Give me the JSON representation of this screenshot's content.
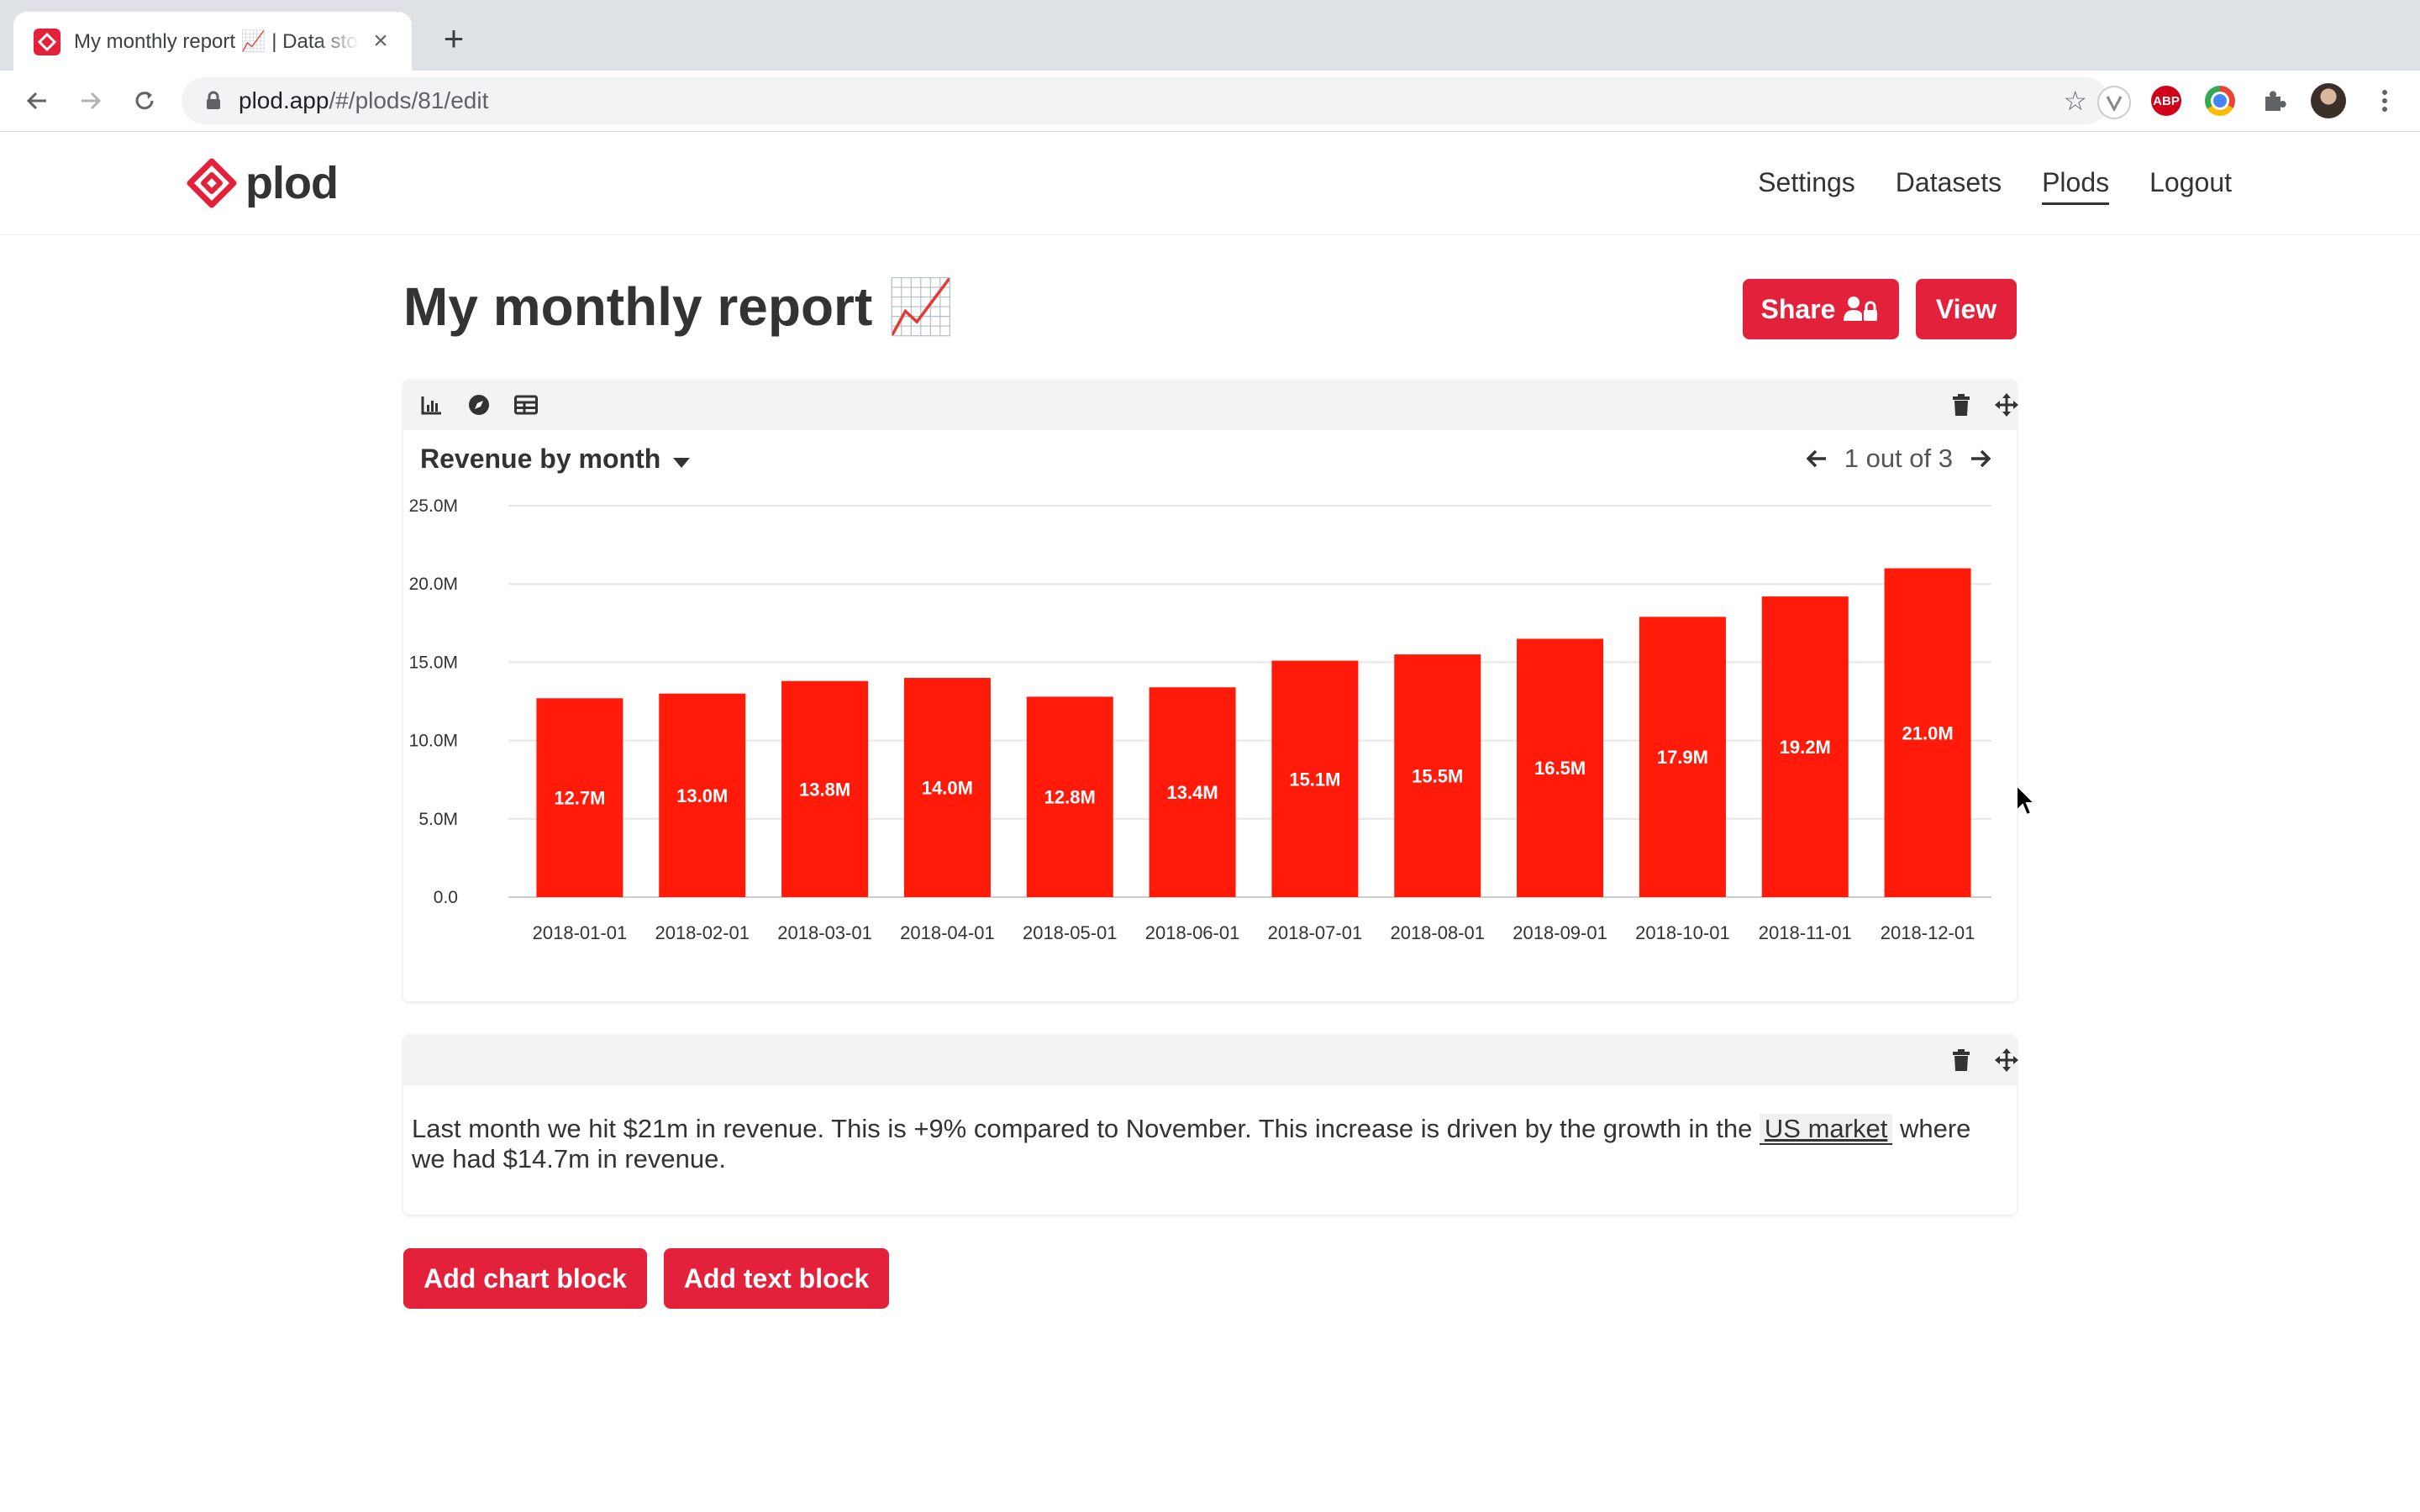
{
  "browser": {
    "tab_title": "My monthly report 📈 | Data storytelling",
    "tab_close": "×",
    "new_tab": "+",
    "url_host": "plod.app",
    "url_path": "/#/plods/81/edit",
    "star": "☆",
    "extensions": [
      "vimium-icon",
      "adblock-icon",
      "chrome-color-icon",
      "puzzle-icon",
      "avatar",
      "kebab-menu-icon"
    ],
    "ext_abp_label": "ABP"
  },
  "app": {
    "logo_text": "plod",
    "nav": [
      "Settings",
      "Datasets",
      "Plods",
      "Logout"
    ],
    "active_nav": "Plods"
  },
  "page": {
    "title": "My monthly report 📈",
    "share_label": "Share",
    "view_label": "View"
  },
  "chart_block": {
    "chart_title": "Revenue by month",
    "pager_text": "1 out of 3",
    "tools": [
      "bar-chart-icon",
      "compass-icon",
      "table-icon"
    ]
  },
  "chart_data": {
    "type": "bar",
    "title": "Revenue by month",
    "xlabel": "",
    "ylabel": "",
    "categories": [
      "2018-01-01",
      "2018-02-01",
      "2018-03-01",
      "2018-04-01",
      "2018-05-01",
      "2018-06-01",
      "2018-07-01",
      "2018-08-01",
      "2018-09-01",
      "2018-10-01",
      "2018-11-01",
      "2018-12-01"
    ],
    "values": [
      12.7,
      13.0,
      13.8,
      14.0,
      12.8,
      13.4,
      15.1,
      15.5,
      16.5,
      17.9,
      19.2,
      21.0
    ],
    "value_labels": [
      "12.7M",
      "13.0M",
      "13.8M",
      "14.0M",
      "12.8M",
      "13.4M",
      "15.1M",
      "15.5M",
      "16.5M",
      "17.9M",
      "19.2M",
      "21.0M"
    ],
    "ylim": [
      0,
      25
    ],
    "yticks": [
      0,
      5,
      10,
      15,
      20,
      25
    ],
    "ytick_labels": [
      "0.0",
      "5.0M",
      "10.0M",
      "15.0M",
      "20.0M",
      "25.0M"
    ],
    "grid": true,
    "bar_color": "#ff1a0a"
  },
  "text_block": {
    "text_before": "Last month we hit $21m in revenue. This is +9% compared to November. This increase is driven by the growth in the ",
    "link_text": "US market",
    "text_after": " where we had $14.7m in revenue."
  },
  "actions": {
    "add_chart": "Add chart block",
    "add_text": "Add text block"
  },
  "colors": {
    "brand": "#e3213a",
    "bar": "#ff1a0a"
  }
}
